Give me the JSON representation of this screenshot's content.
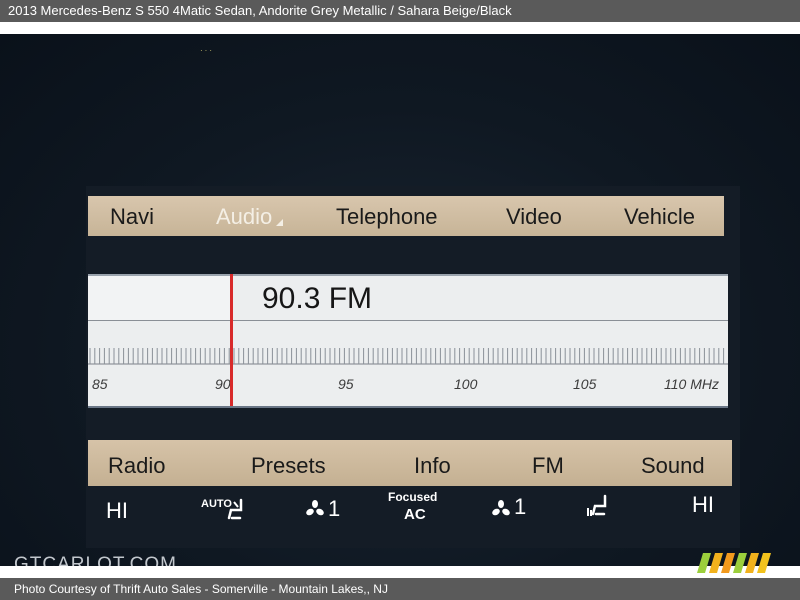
{
  "caption": {
    "title": "2013 Mercedes-Benz S 550 4Matic Sedan,   Andorite Grey Metallic / Sahara Beige/Black",
    "credit": "Photo Courtesy of Thrift Auto Sales - Somerville - Mountain Lakes,, NJ"
  },
  "menu": {
    "items": [
      {
        "label": "Navi",
        "active": false
      },
      {
        "label": "Audio",
        "active": true
      },
      {
        "label": "Telephone",
        "active": false
      },
      {
        "label": "Video",
        "active": false
      },
      {
        "label": "Vehicle",
        "active": false
      }
    ]
  },
  "tuner": {
    "frequency": "90.3 FM",
    "scale_labels": [
      "85",
      "90",
      "95",
      "100",
      "105",
      "110 MHz"
    ],
    "current_mhz": 90.3
  },
  "sources": {
    "items": [
      "Radio",
      "Presets",
      "Info",
      "FM",
      "Sound"
    ]
  },
  "climate": {
    "left_temp": "HI",
    "left_mode": "AUTO",
    "left_fan": "1",
    "center_top": "Focused",
    "center_bottom": "AC",
    "right_fan": "1",
    "right_temp": "HI"
  },
  "watermark": "GTCARLOT.COM",
  "colors": {
    "menu_bar": "#d2bfa4",
    "needle": "#d82a2a",
    "caption_bar": "#5a5a5a"
  }
}
